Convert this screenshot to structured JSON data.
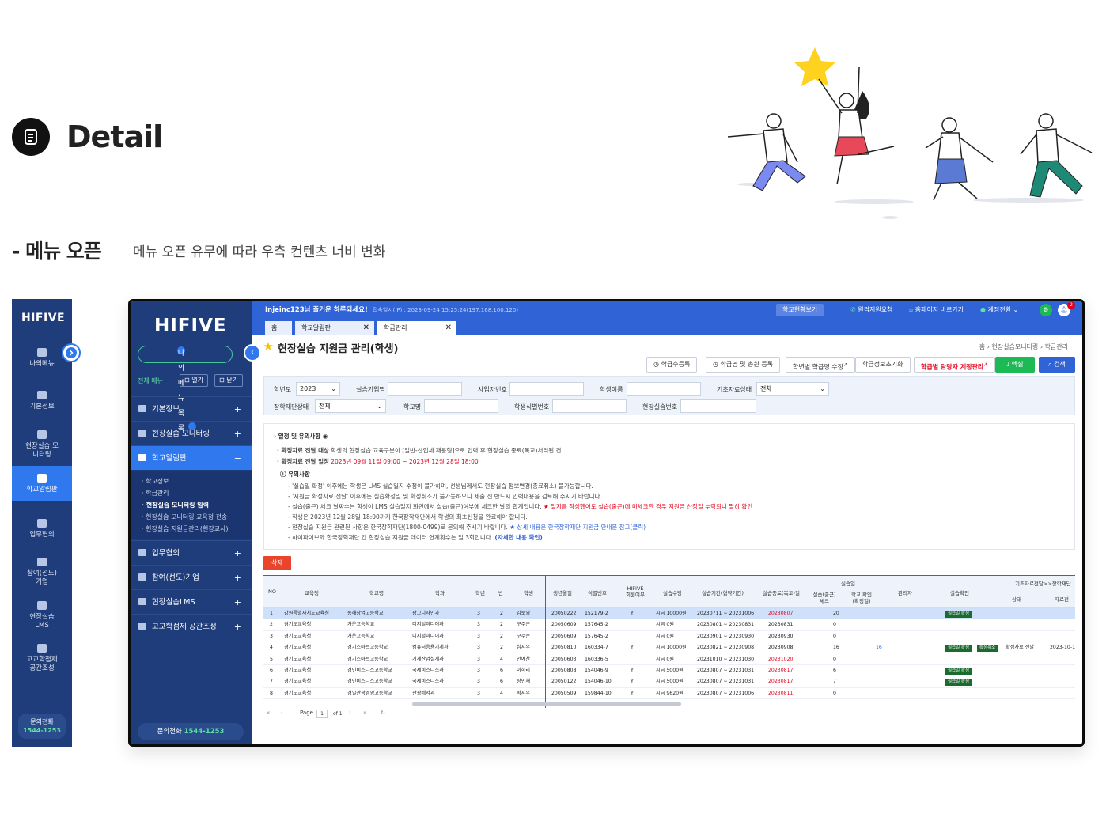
{
  "header": {
    "title": "Detail"
  },
  "section": {
    "title": "- 메뉴 오픈",
    "description": "메뉴 오픈 유무에 따라 우측 컨텐츠 너비 변화"
  },
  "mini_sidebar": {
    "logo": "HIFIVE",
    "items": [
      {
        "label": "나의메뉴",
        "icon": "grid-icon"
      },
      {
        "label": "기본정보",
        "icon": "edit-icon"
      },
      {
        "label": "현장실습 모니터링",
        "icon": "monitor-icon"
      },
      {
        "label": "학교알림판",
        "icon": "board-icon"
      },
      {
        "label": "업무협의",
        "icon": "briefcase-icon"
      },
      {
        "label": "참여(선도) 기업",
        "icon": "building-icon"
      },
      {
        "label": "현장실습 LMS",
        "icon": "chart-icon"
      },
      {
        "label": "고교학점제 공간조성",
        "icon": "location-icon"
      }
    ],
    "call_label": "문의전화",
    "call_number": "1544-1253"
  },
  "app": {
    "logo": "HIFIVE",
    "my_menu_label": "나의메뉴 목록",
    "all_menu_label": "전체 메뉴",
    "open_label": "열기",
    "close_label": "닫기",
    "menus": [
      {
        "label": "기본정보",
        "sign": "+"
      },
      {
        "label": "현장실습 모니터링",
        "sign": "+"
      },
      {
        "label": "학교알림판",
        "sign": "−"
      },
      {
        "label": "업무협의",
        "sign": "+"
      },
      {
        "label": "참여(선도)기업",
        "sign": "+"
      },
      {
        "label": "현장실습LMS",
        "sign": "+"
      },
      {
        "label": "고교학점제 공간조성",
        "sign": "+"
      }
    ],
    "submenus": [
      "· 학교정보",
      "· 학급관리",
      "· 현장실습 모니터링 입력",
      "· 현장실습 모니터링 교육청 전송",
      "· 현장실습 지원금관리(현장교사)"
    ],
    "call_label": "문의전화",
    "call_number": "1544-1253",
    "topbar": {
      "greeting": "Injeinc123님 즐거운 하루되세요!",
      "ip": "접속일시(IP) : 2023-09-24 15:25:24(197.168.100.120)",
      "school_view": "학교현황보기",
      "remote": "원격지원요청",
      "home": "홈페이지 바로가기",
      "account": "계정전환",
      "notif_count": "2"
    },
    "tabs": [
      "홈",
      "학교알림판",
      "학급관리"
    ],
    "page_title": "현장실습 지원금 관리(학생)",
    "breadcrumb": "홈  ›  현장실습모니터링  ›  학급관리",
    "actions": [
      "학급수등록",
      "학급명 및 총원 등록",
      "학년별 학급명 수정",
      "학급정보초기화",
      "학급별 담당자 계정관리",
      "엑셀",
      "검색"
    ],
    "filters": {
      "year_label": "학년도",
      "year_value": "2023",
      "company_label": "실습기업명",
      "bizno_label": "사업자번호",
      "student_label": "학생이름",
      "basic_status_label": "기초자료상태",
      "basic_status_value": "전체",
      "scholar_status_label": "장학재단상태",
      "scholar_status_value": "전체",
      "school_label": "학교명",
      "student_id_label": "학생식별번호",
      "practice_no_label": "현장실습번호"
    },
    "notice": {
      "title": "일정 및 유의사항",
      "l1_label": "· 확정자료 전달 대상",
      "l1_text": "학생의 현장실습 교육구분이 [일반-산업체 재용형]으로 입력 후 현장실습 종료(복교)처리된 건",
      "l2_label": "· 확정자료 전달 일정",
      "l2_text": "2023년 09월 11일 09:00 ~ 2023년 12월 28일 18:00",
      "caution_title": "유의사항",
      "c1": "- '실습일 확정' 이후에는 학생은 LMS 실습일지 수정이 불가하며, 선생님께서도 현장실습 정보변경(종료취소) 불가능합니다.",
      "c2": "- '지원금 확정자료 전달' 이후에는 실습확정일 및 확정취소가 불가능하오니 제출 전 반드시 입력내용을 검토해 주시기 바랍니다.",
      "c3": "- 실습(출근) 체크 날짜수는 학생이 LMS 실습일지 화면에서 실습(출근)여부에 체크한 날의 합계입니다.",
      "c3_red": "★ 일지를 작성했어도 실습(출근)에 미체크한 경우 지원금 산정일 누락되니 필히 확인",
      "c4": "- 학생은 2023년 12월 28일 18:00까지 한국장학재단에서 학생의 최초신청을 완료해야 합니다.",
      "c5": "- 현장실습 지원금 관련된 사항은 한국장학재단(1800-0499)로 문의해 주시기 바랍니다.",
      "c5_blue": "★ 상세 내용은 한국장학재단 지원금 안내문 참고(클릭)",
      "c6": "- 하이파이브와 한국장학재단 간 현장실습 지원금 데이터 연계횟수는 일 3회입니다.",
      "c6_blue": "(자세한 내용 확인)"
    },
    "delete_label": "삭제",
    "grid_headers": [
      "NO",
      "교육청",
      "학교명",
      "학과",
      "학년",
      "반",
      "학생",
      "생년월일",
      "식별번호",
      "HIFIVE 회원여부",
      "실습수당",
      "실습기간(협약기간)",
      "실습종료(복교)일",
      "실습일",
      "실습(출근) 체크",
      "학교 확인 (확정일)",
      "관리자",
      "실습확인",
      "기초자료전달>>장학재단",
      "상태",
      "자료전"
    ],
    "rows": [
      {
        "no": "1",
        "office": "강원특별자치도교육청",
        "school": "동해상업고등학교",
        "dept": "광고디자인과",
        "grade": "3",
        "cls": "2",
        "name": "김보영",
        "birth": "20050222",
        "id": "152179-2",
        "member": "Y",
        "pay": "시급 10000원",
        "period": "20230711 ~ 20231006",
        "end": "20230807",
        "check": "20",
        "confirm": "",
        "badges": [
          "실습일 확정"
        ],
        "send": "",
        "date": ""
      },
      {
        "no": "2",
        "office": "경기도교육청",
        "school": "가온고등학교",
        "dept": "디지털미디어과",
        "grade": "3",
        "cls": "2",
        "name": "구주은",
        "birth": "20050609",
        "id": "157645-2",
        "member": "",
        "pay": "시급 0원",
        "period": "20230801 ~ 20230831",
        "end": "20230831",
        "check": "0",
        "confirm": "",
        "badges": [],
        "send": "",
        "date": ""
      },
      {
        "no": "3",
        "office": "경기도교육청",
        "school": "가온고등학교",
        "dept": "디지털미디어과",
        "grade": "3",
        "cls": "2",
        "name": "구주은",
        "birth": "20050609",
        "id": "157645-2",
        "member": "",
        "pay": "시급 0원",
        "period": "20230901 ~ 20230930",
        "end": "20230930",
        "check": "0",
        "confirm": "",
        "badges": [],
        "send": "",
        "date": ""
      },
      {
        "no": "4",
        "office": "경기도교육청",
        "school": "경기스마트고등학교",
        "dept": "컴퓨터응용기계과",
        "grade": "3",
        "cls": "2",
        "name": "심지우",
        "birth": "20050810",
        "id": "160334-7",
        "member": "Y",
        "pay": "시급 10000원",
        "period": "20230821 ~ 20230908",
        "end": "20230908",
        "check": "16",
        "confirm": "16",
        "badges": [
          "실습일 확정",
          "확정취소"
        ],
        "send": "확정자료 전달",
        "date": "2023-10-1"
      },
      {
        "no": "5",
        "office": "경기도교육청",
        "school": "경기스마트고등학교",
        "dept": "기계산업설계과",
        "grade": "3",
        "cls": "4",
        "name": "안예찬",
        "birth": "20050603",
        "id": "160336-5",
        "member": "",
        "pay": "시급 0원",
        "period": "20231010 ~ 20231030",
        "end": "20231020",
        "check": "0",
        "confirm": "",
        "badges": [],
        "send": "",
        "date": ""
      },
      {
        "no": "6",
        "office": "경기도교육청",
        "school": "경민비즈니스고등학교",
        "dept": "국제비즈니스과",
        "grade": "3",
        "cls": "6",
        "name": "이하리",
        "birth": "20050808",
        "id": "154046-9",
        "member": "Y",
        "pay": "시급 5000원",
        "period": "20230807 ~ 20231031",
        "end": "20230817",
        "check": "6",
        "confirm": "",
        "badges": [
          "실습일 확정"
        ],
        "send": "",
        "date": ""
      },
      {
        "no": "7",
        "office": "경기도교육청",
        "school": "경민비즈니스고등학교",
        "dept": "국제비즈니스과",
        "grade": "3",
        "cls": "6",
        "name": "장민채",
        "birth": "20050122",
        "id": "154046-10",
        "member": "Y",
        "pay": "시급 5000원",
        "period": "20230807 ~ 20231031",
        "end": "20230817",
        "check": "7",
        "confirm": "",
        "badges": [
          "실습일 확정"
        ],
        "send": "",
        "date": ""
      },
      {
        "no": "8",
        "office": "경기도교육청",
        "school": "경일관광경영고등학교",
        "dept": "관광레저과",
        "grade": "3",
        "cls": "4",
        "name": "박지우",
        "birth": "20050509",
        "id": "159844-10",
        "member": "Y",
        "pay": "시급 9620원",
        "period": "20230807 ~ 20231006",
        "end": "20230811",
        "check": "0",
        "confirm": "",
        "badges": [],
        "send": "",
        "date": ""
      }
    ],
    "pager": {
      "page_label": "Page",
      "page": "1",
      "of": "of 1"
    }
  }
}
